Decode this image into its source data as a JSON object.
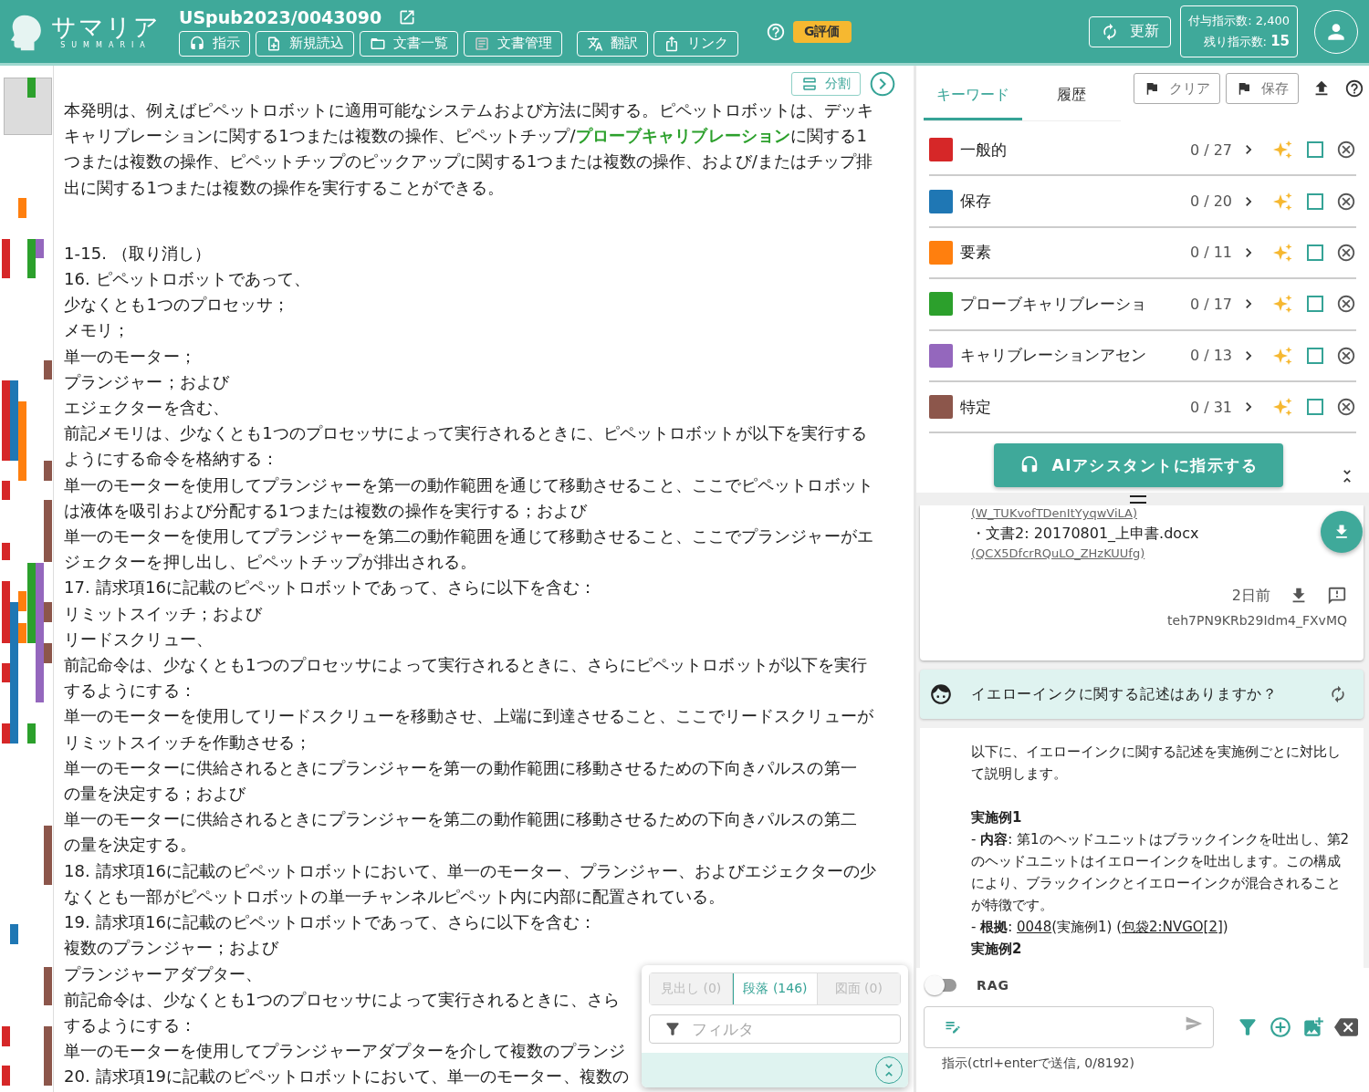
{
  "header": {
    "logo": {
      "name": "サマリア",
      "sub": "SUMMARIA"
    },
    "title": "USpub2023/0043090",
    "toolbar": [
      {
        "label": "指示"
      },
      {
        "label": "新規読込"
      },
      {
        "label": "文書一覧"
      },
      {
        "label": "文書管理"
      },
      {
        "label": "翻訳"
      },
      {
        "label": "リンク"
      }
    ],
    "badge": "G評価",
    "refresh": "更新",
    "quota": {
      "given": "付与指示数: 2,400",
      "remaining": "残り指示数: **15**"
    }
  },
  "document": {
    "split_button": "分割",
    "blocks": [
      {
        "lines": [
          "本発明は、例えばピペットロボットに適用可能なシステムおよび方法に関する。ピペットロボットは、デッキ",
          "キャリブレーションに関する1つまたは複数の操作、ピペットチップ/**プローブキャリブレーション**に関する1",
          "つまたは複数の操作、ピペットチップのピックアップに関する1つまたは複数の操作、および/またはチップ排",
          "出に関する1つまたは複数の操作を実行することができる。"
        ]
      },
      {
        "lines": [
          "1-15. （取り消し）",
          "16. ピペットロボットであって、",
          "少なくとも1つのプロセッサ；",
          "メモリ；",
          "単一のモーター；",
          "プランジャー；および",
          "エジェクターを含む、",
          "前記メモリは、少なくとも1つのプロセッサによって実行されるときに、ピペットロボットが以下を実行する",
          "ようにする命令を格納する：",
          "単一のモーターを使用してプランジャーを第一の動作範囲を通じて移動させること、ここでピペットロボット",
          "は液体を吸引および分配する1つまたは複数の操作を実行する；および",
          "単一のモーターを使用してプランジャーを第二の動作範囲を通じて移動させること、ここでプランジャーがエ",
          "ジェクターを押し出し、ピペットチップが排出される。",
          "17. 請求項16に記載のピペットロボットであって、さらに以下を含む：",
          "リミットスイッチ；および",
          "リードスクリュー、",
          "前記命令は、少なくとも1つのプロセッサによって実行されるときに、さらにピペットロボットが以下を実行",
          "するようにする：",
          "単一のモーターを使用してリードスクリューを移動させ、上端に到達させること、ここでリードスクリューが",
          "リミットスイッチを作動させる；",
          "単一のモーターに供給されるときにプランジャーを第一の動作範囲に移動させるための下向きパルスの第一",
          "の量を決定する；および",
          "単一のモーターに供給されるときにプランジャーを第二の動作範囲に移動させるための下向きパルスの第二",
          "の量を決定する。",
          "18. 請求項16に記載のピペットロボットにおいて、単一のモーター、プランジャー、およびエジェクターの少",
          "なくとも一部がピペットロボットの単一チャンネルピペット内に内部に配置されている。",
          "19. 請求項16に記載のピペットロボットであって、さらに以下を含む：",
          "複数のプランジャー；および",
          "プランジャーアダプター、",
          "前記命令は、少なくとも1つのプロセッサによって実行されるときに、さら",
          "するようにする：",
          "単一のモーターを使用してプランジャーアダプターを介して複数のプランジ",
          "20. 請求項19に記載のピペットロボットにおいて、単一のモーター、複数の"
        ]
      }
    ]
  },
  "filter_popup": {
    "tabs": [
      {
        "label": "見出し (0)",
        "selected": false,
        "disabled": true
      },
      {
        "label": "段落 (146)",
        "selected": true,
        "disabled": false
      },
      {
        "label": "図面 (0)",
        "selected": false,
        "disabled": true
      }
    ],
    "placeholder": "フィルタ"
  },
  "panel": {
    "tabs": [
      {
        "label": "キーワード",
        "selected": true
      },
      {
        "label": "履歴",
        "selected": false
      }
    ],
    "clear_button": "クリア",
    "save_button": "保存",
    "keywords": [
      {
        "name": "一般的",
        "count": "0 / 27",
        "color": "#d62728",
        "checked": false
      },
      {
        "name": "保存",
        "count": "0 / 20",
        "color": "#1f77b4",
        "checked": false
      },
      {
        "name": "要素",
        "count": "0 / 11",
        "color": "#ff7f0e",
        "checked": false
      },
      {
        "name": "プローブキャリブレーショ",
        "count": "0 / 17",
        "color": "#2ca02c",
        "checked": false
      },
      {
        "name": "キャリブレーションアセン",
        "count": "0 / 13",
        "color": "#9467bd",
        "checked": false
      },
      {
        "name": "特定",
        "count": "0 / 31",
        "color": "#8c564b",
        "checked": false
      }
    ],
    "ai_button": "AIアシスタントに指示する",
    "history_card": {
      "link_top": "(W_TUKvofTDenItYyqwViLA)",
      "file": "・文書2: 20170801_上申書.docx",
      "link_bottom": "(QCX5DfcrRQuLO_ZHzKUUfg)",
      "time": "2日前",
      "id": "teh7PN9KRb29Idm4_FXvMQ"
    },
    "question": "イエローインクに関する記述はありますか？",
    "answer": [
      {
        "kind": "text",
        "text": "以下に、イエローインクに関する記述を実施例ごとに対比して説明します。"
      },
      {
        "kind": "heading",
        "text": "実施例1"
      },
      {
        "kind": "text",
        "text": "- **内容**: 第1のヘッドユニットはブラックインクを吐出し、第2のヘッドユニットはイエローインクを吐出します。この構成により、ブラックインクとイエローインクが混合されることが特徴です。"
      },
      {
        "kind": "evidence",
        "label": "- **根拠**: ",
        "parts": [
          {
            "text": "0048",
            "link": true
          },
          {
            "text": "(実施例1) (",
            "link": false
          },
          {
            "text": "包袋2:NVGO[2]",
            "link": true
          }
        ],
        "tail": ")"
      },
      {
        "kind": "heading",
        "text": "実施例2"
      }
    ],
    "rag": {
      "label": "RAG",
      "on": false
    },
    "input_caption": "指示(ctrl+enterで送信, 0/8192)"
  }
}
